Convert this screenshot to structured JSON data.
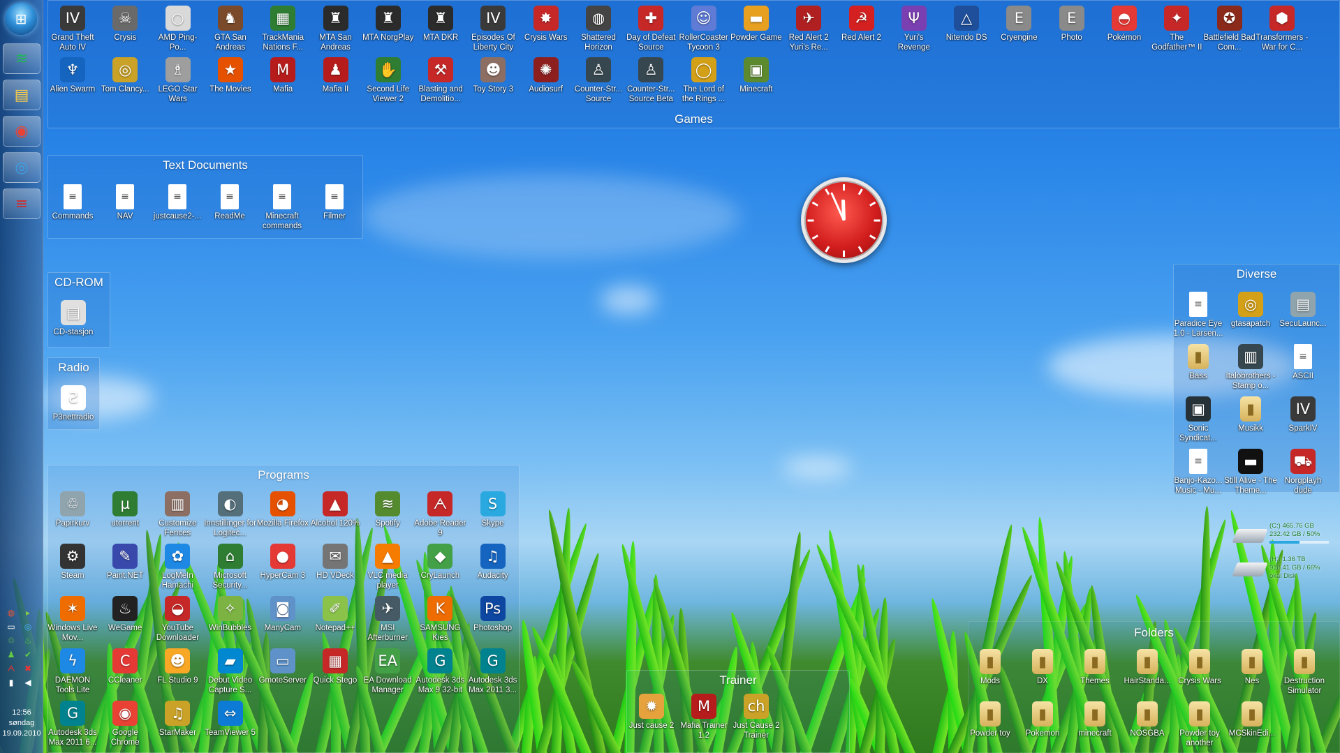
{
  "taskbar": {
    "start_icon": "windows-orb-icon",
    "buttons": [
      {
        "name": "spotify-taskbar-button",
        "glyph": "≋",
        "color": "#1db954"
      },
      {
        "name": "explorer-taskbar-button",
        "glyph": "▤",
        "color": "#f2c94c"
      },
      {
        "name": "chrome-taskbar-button",
        "glyph": "◉",
        "color": "#e94235"
      },
      {
        "name": "messenger-taskbar-button",
        "glyph": "◎",
        "color": "#3aa0e8"
      },
      {
        "name": "fences-taskbar-button",
        "glyph": "≡",
        "color": "#d12b2b"
      }
    ],
    "time": "12:56",
    "day": "søndag",
    "date": "19.09.2010"
  },
  "fences": {
    "games": {
      "title": "Games",
      "row1": [
        {
          "label": "Grand Theft Auto IV",
          "glyph": "IV",
          "color": "#3a3a3a"
        },
        {
          "label": "Crysis",
          "glyph": "☠",
          "color": "#6a6a6a"
        },
        {
          "label": "AMD Ping-Po...",
          "glyph": "○",
          "color": "#d9d9d9"
        },
        {
          "label": "GTA San Andreas",
          "glyph": "♞",
          "color": "#7a4a2a"
        },
        {
          "label": "TrackMania Nations F...",
          "glyph": "▦",
          "color": "#2e7d32"
        },
        {
          "label": "MTA San Andreas",
          "glyph": "♜",
          "color": "#2b2b2b"
        },
        {
          "label": "MTA NorgPlay",
          "glyph": "♜",
          "color": "#2b2b2b"
        },
        {
          "label": "MTA DKR",
          "glyph": "♜",
          "color": "#2b2b2b"
        },
        {
          "label": "Episodes Of Liberty City",
          "glyph": "IV",
          "color": "#3a3a3a"
        },
        {
          "label": "Crysis Wars",
          "glyph": "✸",
          "color": "#c62828"
        },
        {
          "label": "Shattered Horizon",
          "glyph": "◍",
          "color": "#444"
        },
        {
          "label": "Day of Defeat Source",
          "glyph": "✚",
          "color": "#c62828"
        },
        {
          "label": "RollerCoaster Tycoon 3",
          "glyph": "☺",
          "color": "#5f7bd6"
        },
        {
          "label": "Powder Game",
          "glyph": "▬",
          "color": "#e8a020"
        },
        {
          "label": "Red Alert 2 Yuri's Re...",
          "glyph": "✈",
          "color": "#b02020"
        },
        {
          "label": "Red Alert 2",
          "glyph": "☭",
          "color": "#d42020"
        },
        {
          "label": "Yuri's Revenge",
          "glyph": "Ψ",
          "color": "#7a3fb0"
        },
        {
          "label": "Nitendo DS",
          "glyph": "△",
          "color": "#1f4f9a"
        },
        {
          "label": "Cryengine",
          "glyph": "E",
          "color": "#8a8a8a"
        },
        {
          "label": "Photo",
          "glyph": "E",
          "color": "#8a8a8a"
        },
        {
          "label": "Pokémon",
          "glyph": "◓",
          "color": "#e53935"
        },
        {
          "label": "The Godfather™ II",
          "glyph": "✦",
          "color": "#c62828"
        },
        {
          "label": "Battlefield Bad Com...",
          "glyph": "✪",
          "color": "#8b2a1a"
        },
        {
          "label": "Transformers - War for C...",
          "glyph": "⬢",
          "color": "#c62828"
        }
      ],
      "row2": [
        {
          "label": "Alien Swarm",
          "glyph": "♆",
          "color": "#1565c0"
        },
        {
          "label": "Tom Clancy...",
          "glyph": "◎",
          "color": "#c9a227"
        },
        {
          "label": "LEGO Star Wars",
          "glyph": "♗",
          "color": "#9e9e9e"
        },
        {
          "label": "The Movies",
          "glyph": "★",
          "color": "#e65100"
        },
        {
          "label": "Mafia",
          "glyph": "M",
          "color": "#b71c1c"
        },
        {
          "label": "Mafia II",
          "glyph": "♟",
          "color": "#b71c1c"
        },
        {
          "label": "Second Life Viewer 2",
          "glyph": "✋",
          "color": "#2e7d32"
        },
        {
          "label": "Blasting and Demolitio...",
          "glyph": "⚒",
          "color": "#c62828"
        },
        {
          "label": "Toy Story 3",
          "glyph": "☻",
          "color": "#8d6e63"
        },
        {
          "label": "Audiosurf",
          "glyph": "✺",
          "color": "#8e1f1f"
        },
        {
          "label": "Counter-Str... Source",
          "glyph": "♙",
          "color": "#37474f"
        },
        {
          "label": "Counter-Str... Source Beta",
          "glyph": "♙",
          "color": "#37474f"
        },
        {
          "label": "The Lord of the Rings ...",
          "glyph": "◯",
          "color": "#d4a017"
        },
        {
          "label": "Minecraft",
          "glyph": "▣",
          "color": "#5d8a2e"
        }
      ]
    },
    "text_documents": {
      "title": "Text Documents",
      "items": [
        "Commands",
        "NAV",
        "justcause2-...",
        "ReadMe",
        "Minecraft commands",
        "Filmer"
      ]
    },
    "cdrom": {
      "title": "CD-ROM",
      "items": [
        {
          "label": "CD-stasjon",
          "glyph": "▤",
          "color": "#e0e0e0"
        }
      ]
    },
    "radio": {
      "title": "Radio",
      "items": [
        {
          "label": "P3nettradio",
          "glyph": "Ƨ",
          "color": "#ffffff"
        }
      ]
    },
    "programs": {
      "title": "Programs",
      "items": [
        {
          "label": "Papirkurv",
          "glyph": "♲",
          "color": "#90a4ae"
        },
        {
          "label": "utorrent",
          "glyph": "µ",
          "color": "#2e7d32"
        },
        {
          "label": "Customize Fences",
          "glyph": "▥",
          "color": "#8d6e63"
        },
        {
          "label": "Innstillinger for Logitec...",
          "glyph": "◐",
          "color": "#546e7a"
        },
        {
          "label": "Mozilla Firefox",
          "glyph": "◕",
          "color": "#e65100"
        },
        {
          "label": "Alcohol 120%",
          "glyph": "▲",
          "color": "#c62828"
        },
        {
          "label": "Spotify",
          "glyph": "≋",
          "color": "#558b2f"
        },
        {
          "label": "Adobe Reader 9",
          "glyph": "ᗅ",
          "color": "#c62828"
        },
        {
          "label": "Skype",
          "glyph": "S",
          "color": "#29a9e0"
        },
        {
          "label": "Steam",
          "glyph": "⚙",
          "color": "#333"
        },
        {
          "label": "Paint.NET",
          "glyph": "✎",
          "color": "#3949ab"
        },
        {
          "label": "LogMeIn Hamachi",
          "glyph": "✿",
          "color": "#1e88e5"
        },
        {
          "label": "Microsoft Security...",
          "glyph": "⌂",
          "color": "#2e7d32"
        },
        {
          "label": "HyperCam 3",
          "glyph": "●",
          "color": "#e53935"
        },
        {
          "label": "HD VDeck",
          "glyph": "✉",
          "color": "#757575"
        },
        {
          "label": "VLC media player",
          "glyph": "▲",
          "color": "#f57c00"
        },
        {
          "label": "CryLaunch",
          "glyph": "◆",
          "color": "#43a047"
        },
        {
          "label": "Audacity",
          "glyph": "♫",
          "color": "#1565c0"
        },
        {
          "label": "Windows Live Mov...",
          "glyph": "✶",
          "color": "#ef6c00"
        },
        {
          "label": "WeGame",
          "glyph": "♨",
          "color": "#222"
        },
        {
          "label": "YouTube Downloader",
          "glyph": "◒",
          "color": "#c62828"
        },
        {
          "label": "WinBubbles",
          "glyph": "✧",
          "color": "#7cb342"
        },
        {
          "label": "ManyCam",
          "glyph": "◙",
          "color": "#5e92c9"
        },
        {
          "label": "Notepad++",
          "glyph": "✐",
          "color": "#8bc34a"
        },
        {
          "label": "MSI Afterburner",
          "glyph": "✈",
          "color": "#455a64"
        },
        {
          "label": "SAMSUNG Kies",
          "glyph": "K",
          "color": "#ef6c00"
        },
        {
          "label": "Photoshop",
          "glyph": "Ps",
          "color": "#0d47a1"
        },
        {
          "label": "DAEMON Tools Lite",
          "glyph": "ϟ",
          "color": "#1e88e5"
        },
        {
          "label": "CCleaner",
          "glyph": "C",
          "color": "#e53935"
        },
        {
          "label": "FL Studio 9",
          "glyph": "☻",
          "color": "#f9a825"
        },
        {
          "label": "Debut Video Capture S...",
          "glyph": "▰",
          "color": "#0288d1"
        },
        {
          "label": "GmoteServer",
          "glyph": "▭",
          "color": "#5e92c9"
        },
        {
          "label": "Quick Stego",
          "glyph": "▦",
          "color": "#c62828"
        },
        {
          "label": "EA Download Manager",
          "glyph": "EA",
          "color": "#43a047"
        },
        {
          "label": "Autodesk 3ds Max 9 32-bit",
          "glyph": "G",
          "color": "#00838f"
        },
        {
          "label": "Autodesk 3ds Max 2011 3...",
          "glyph": "G",
          "color": "#00838f"
        },
        {
          "label": "Autodesk 3ds Max 2011 6...",
          "glyph": "G",
          "color": "#00838f"
        },
        {
          "label": "Google Chrome",
          "glyph": "◉",
          "color": "#e94235"
        },
        {
          "label": "StarMaker",
          "glyph": "♫",
          "color": "#c9a227"
        },
        {
          "label": "TeamViewer 5",
          "glyph": "⇔",
          "color": "#0d7bd6"
        }
      ]
    },
    "trainer": {
      "title": "Trainer",
      "items": [
        {
          "label": "Just cause 2",
          "glyph": "✹",
          "color": "#e6a23c"
        },
        {
          "label": "Mafia Trainer 1.2",
          "glyph": "M",
          "color": "#b71c1c"
        },
        {
          "label": "Just Cause 2 Trainer",
          "glyph": "ch",
          "color": "#c9a227"
        }
      ]
    },
    "diverse": {
      "title": "Diverse",
      "items": [
        {
          "label": "Paradice Eye 1.0 - Larsen...",
          "type": "doc"
        },
        {
          "label": "gtasapatch",
          "glyph": "◎",
          "color": "#d4a017"
        },
        {
          "label": "SecuLaunc...",
          "glyph": "▤",
          "color": "#90a4ae"
        },
        {
          "label": "Bass",
          "type": "folder"
        },
        {
          "label": "Italobrothers - Stamp o...",
          "glyph": "▥",
          "color": "#37474f"
        },
        {
          "label": "ASCII",
          "type": "doc"
        },
        {
          "label": "Sonic Syndicat...",
          "glyph": "▣",
          "color": "#263238"
        },
        {
          "label": "Musikk",
          "type": "folder"
        },
        {
          "label": "SparkIV",
          "glyph": "IV",
          "color": "#3a3a3a"
        },
        {
          "label": "Banjo-Kazo... Music - Mu...",
          "type": "doc"
        },
        {
          "label": "Still Alive - The Theme...",
          "glyph": "▬",
          "color": "#111"
        },
        {
          "label": "Norgplayh dude",
          "glyph": "⛟",
          "color": "#c62828"
        }
      ]
    },
    "folders": {
      "title": "Folders",
      "items": [
        "Mods",
        "DX",
        "Themes",
        "HairStanda...",
        "Crysis Wars",
        "Nes",
        "Destruction Simulator",
        "Powder toy",
        "Pokemon",
        "minecraft",
        "NOSGBA",
        "Powder toy another",
        "MCSkinEdi..."
      ]
    }
  },
  "drives": [
    {
      "line1": "(C:) 465.76 GB",
      "line2": "232.42 GB / 50%",
      "usage_percent": 50
    },
    {
      "line1": "(H:) 1.36 TB",
      "line2": "918.41 GB / 66%",
      "line3": "okal Disk",
      "usage_percent": 66
    }
  ],
  "clock_gadget": {
    "hour": 11,
    "minute": 56
  }
}
